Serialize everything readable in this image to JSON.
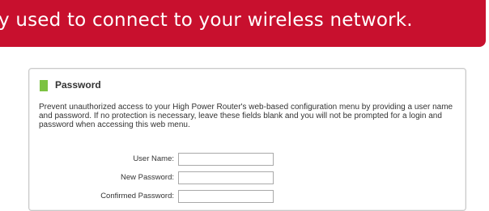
{
  "banner": {
    "text": "y used to connect to your wireless network."
  },
  "password_section": {
    "title": "Password",
    "description": "Prevent unauthorized access to your High Power Router's web-based configuration menu by providing a user name and password. If no protection is necessary, leave these fields blank and you will not be prompted for a login and password when accessing this web menu.",
    "fields": [
      {
        "label": "User Name:",
        "value": ""
      },
      {
        "label": "New Password:",
        "value": ""
      },
      {
        "label": "Confirmed Password:",
        "value": ""
      }
    ]
  },
  "colors": {
    "banner_bg": "#c8102e",
    "section_marker": "#7cc242"
  }
}
